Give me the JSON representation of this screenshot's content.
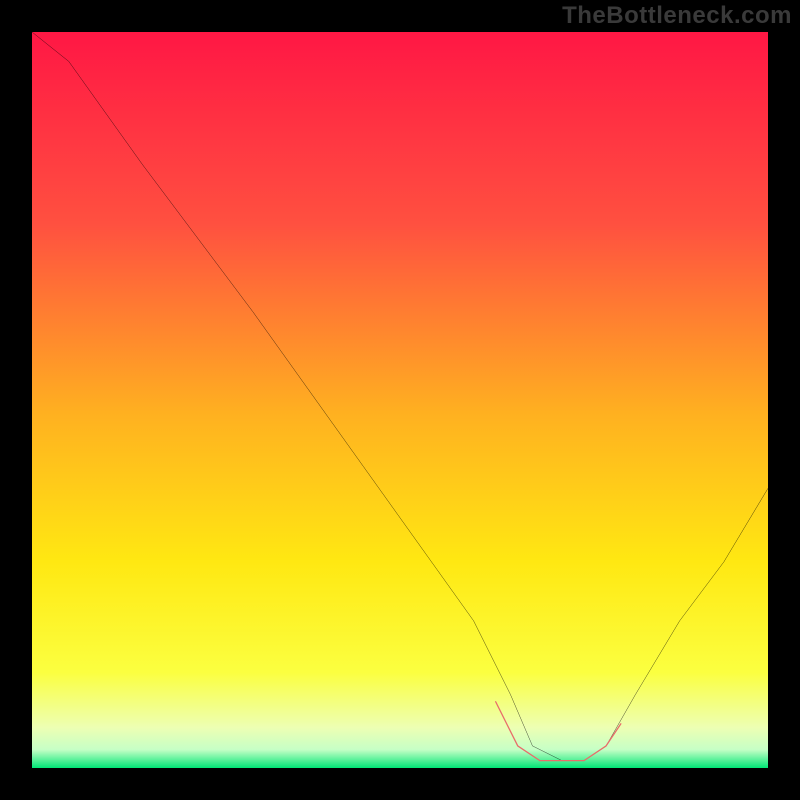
{
  "watermark": "TheBottleneck.com",
  "chart_data": {
    "type": "line",
    "title": "",
    "xlabel": "",
    "ylabel": "",
    "xlim": [
      0,
      100
    ],
    "ylim": [
      0,
      100
    ],
    "series": [
      {
        "name": "bottleneck-curve",
        "x": [
          0,
          5,
          15,
          30,
          45,
          55,
          60,
          65,
          68,
          72,
          75,
          78,
          82,
          88,
          94,
          100
        ],
        "values": [
          100,
          96,
          82,
          62,
          41,
          27,
          20,
          10,
          3,
          1,
          1,
          3,
          10,
          20,
          28,
          38
        ]
      }
    ],
    "highlight_segment": {
      "name": "low-bottleneck-range",
      "x": [
        63,
        66,
        69,
        72,
        75,
        78,
        80
      ],
      "values": [
        9,
        3,
        1,
        1,
        1,
        3,
        6
      ]
    },
    "gradient_stops": [
      {
        "t": 0.0,
        "color": "#ff1744"
      },
      {
        "t": 0.26,
        "color": "#ff5040"
      },
      {
        "t": 0.52,
        "color": "#ffb120"
      },
      {
        "t": 0.72,
        "color": "#ffe812"
      },
      {
        "t": 0.87,
        "color": "#fbff40"
      },
      {
        "t": 0.945,
        "color": "#edffb3"
      },
      {
        "t": 0.975,
        "color": "#c6ffc6"
      },
      {
        "t": 1.0,
        "color": "#00e676"
      }
    ]
  }
}
